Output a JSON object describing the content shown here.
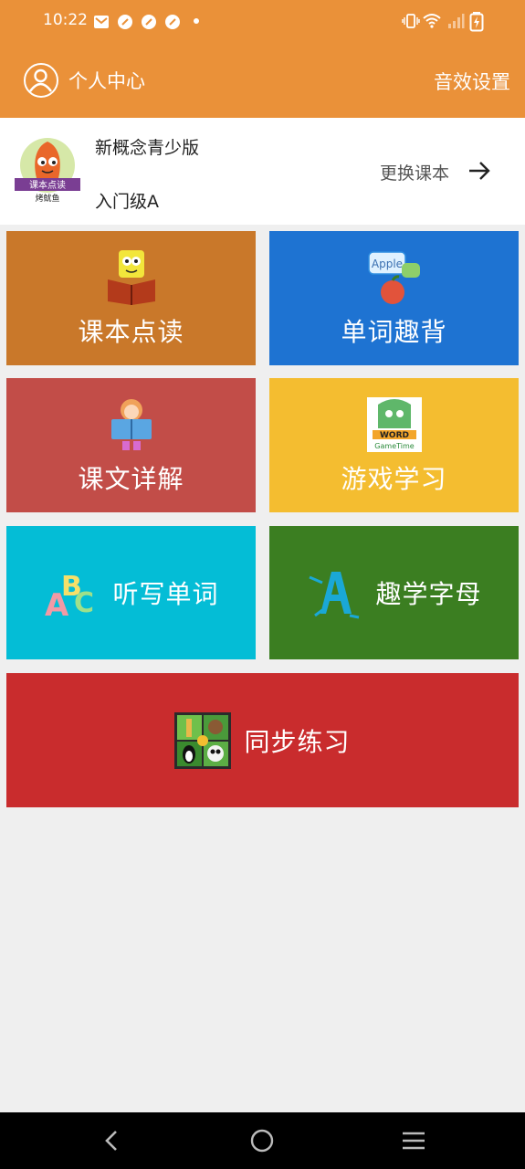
{
  "status_bar": {
    "time": "10:22"
  },
  "header": {
    "profile_label": "个人中心",
    "sound_settings": "音效设置",
    "accent_color": "#ea9139"
  },
  "course": {
    "logo_text_1": "课本点读",
    "logo_text_2": "烤鱿鱼",
    "book_title": "新概念青少版",
    "book_level": "入门级A",
    "change_label": "更换课本"
  },
  "tiles": [
    {
      "label": "课本点读",
      "color": "#c9782a",
      "icon": "sponge-reading-icon"
    },
    {
      "label": "单词趣背",
      "color": "#1e73d2",
      "icon": "apple-speech-icon"
    },
    {
      "label": "课文详解",
      "color": "#c24d48",
      "icon": "girl-reading-icon"
    },
    {
      "label": "游戏学习",
      "color": "#f4bd30",
      "icon": "word-game-icon"
    },
    {
      "label": "听写单词",
      "color": "#04bdd6",
      "icon": "abc-letters-icon"
    },
    {
      "label": "趣学字母",
      "color": "#3b7e21",
      "icon": "letter-a-icon"
    },
    {
      "label": "同步练习",
      "color": "#c92c2d",
      "icon": "animal-grid-icon"
    }
  ]
}
